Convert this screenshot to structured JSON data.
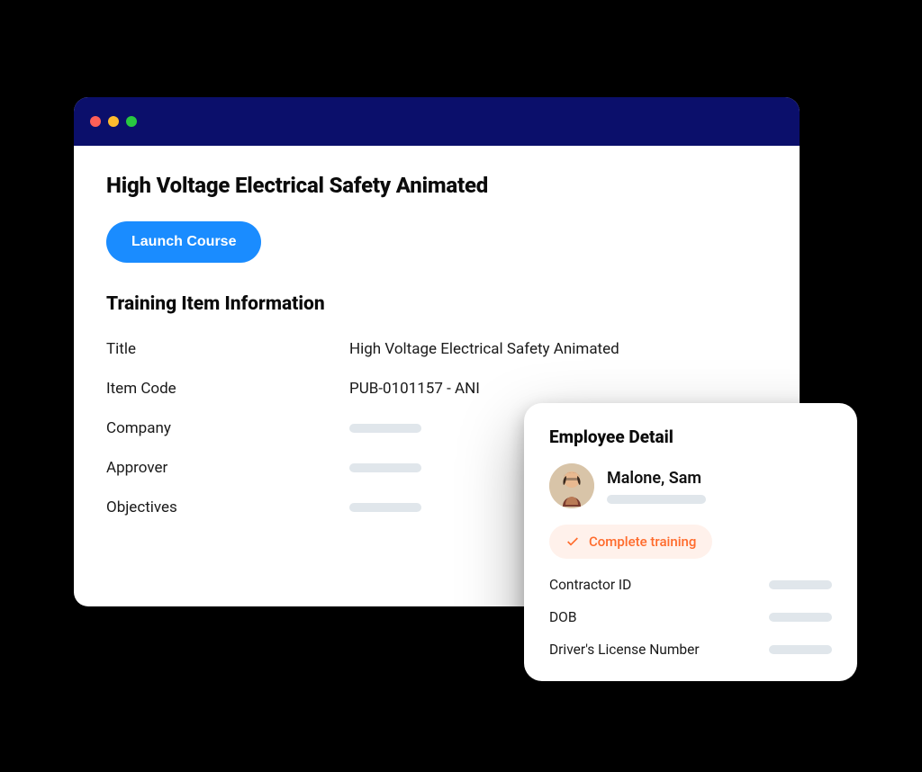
{
  "main": {
    "page_title": "High Voltage Electrical Safety Animated",
    "launch_button": "Launch Course",
    "section_title": "Training Item Information",
    "fields": {
      "title": {
        "label": "Title",
        "value": "High Voltage Electrical Safety Animated"
      },
      "item_code": {
        "label": "Item Code",
        "value": "PUB-0101157 - ANI"
      },
      "company": {
        "label": "Company"
      },
      "approver": {
        "label": "Approver"
      },
      "objectives": {
        "label": "Objectives"
      }
    }
  },
  "employee_card": {
    "title": "Employee Detail",
    "name": "Malone, Sam",
    "status": "Complete training",
    "fields": {
      "contractor_id": {
        "label": "Contractor ID"
      },
      "dob": {
        "label": "DOB"
      },
      "license": {
        "label": "Driver's License Number"
      }
    }
  },
  "colors": {
    "titlebar": "#0b0f6b",
    "button": "#1a8cff",
    "status_accent": "#ff6b2c",
    "status_bg": "#fff1eb"
  }
}
